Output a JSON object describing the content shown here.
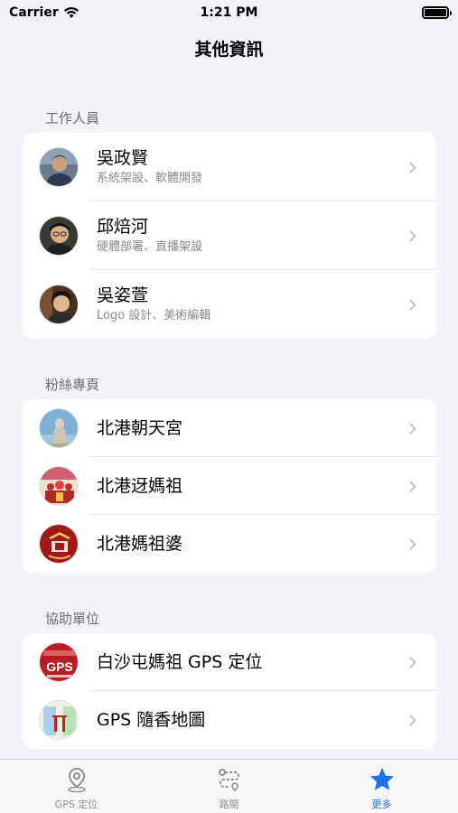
{
  "status": {
    "carrier": "Carrier",
    "time": "1:21 PM"
  },
  "nav": {
    "title": "其他資訊"
  },
  "sections": [
    {
      "header": "工作人員",
      "items": [
        {
          "title": "吳政賢",
          "subtitle": "系統架設、軟體開發",
          "avatar": "person-avatar-1"
        },
        {
          "title": "邱焙河",
          "subtitle": "硬體部署、直播架設",
          "avatar": "person-avatar-2"
        },
        {
          "title": "吳姿萱",
          "subtitle": "Logo 設計、美術編輯",
          "avatar": "person-avatar-3"
        }
      ]
    },
    {
      "header": "粉絲專頁",
      "items": [
        {
          "title": "北港朝天宮",
          "avatar": "temple-statue-avatar"
        },
        {
          "title": "北港迓媽祖",
          "avatar": "procession-avatar"
        },
        {
          "title": "北港媽祖婆",
          "avatar": "red-logo-avatar"
        }
      ]
    },
    {
      "header": "協助單位",
      "items": [
        {
          "title": "白沙屯媽祖 GPS 定位",
          "avatar": "gps-logo-avatar",
          "logo_text": "GPS"
        },
        {
          "title": "GPS 隨香地圖",
          "avatar": "map-logo-avatar"
        }
      ]
    }
  ],
  "tabs": [
    {
      "label": "GPS 定位",
      "icon": "location-pin-icon",
      "active": false
    },
    {
      "label": "路關",
      "icon": "route-icon",
      "active": false
    },
    {
      "label": "更多",
      "icon": "star-icon",
      "active": true
    }
  ],
  "colors": {
    "accent": "#1a73e8",
    "background": "#f2f2f7"
  }
}
